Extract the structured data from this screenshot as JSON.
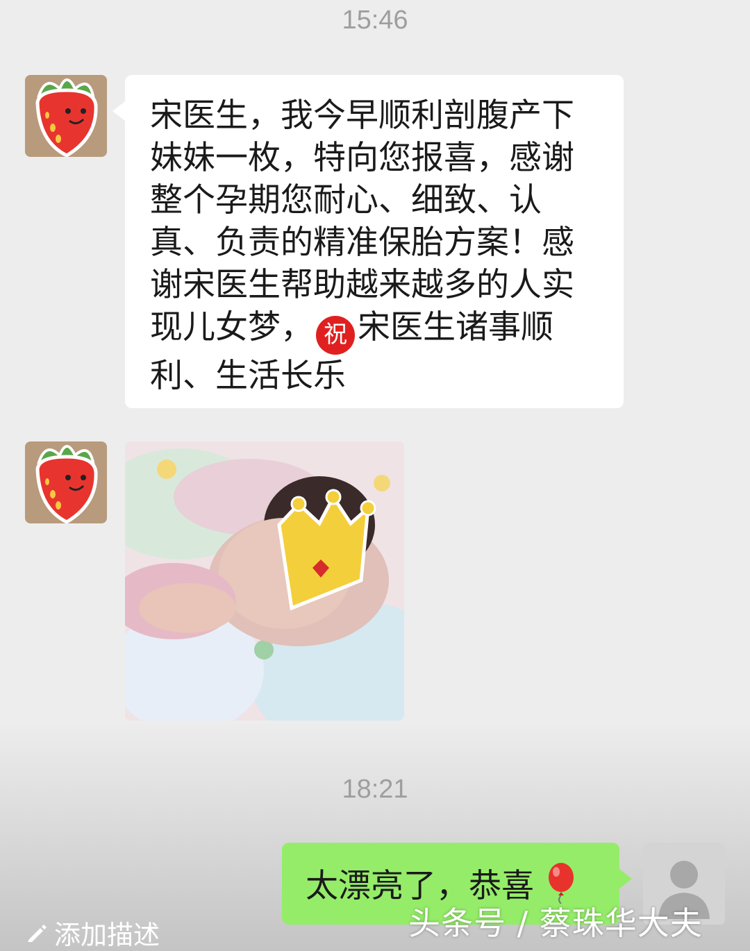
{
  "chat": {
    "timestamp_1": "15:46",
    "message_1_lines": [
      "宋医生，我今早顺利剖腹产下",
      "妹妹一枚，特向您报喜，感谢",
      "整个孕期您耐心、细致、认",
      "真、负责的精准保胎方案！感",
      "谢宋医生帮助越来越多的人实",
      "现儿女梦，",
      "宋医生诸事顺",
      "利、生活长乐"
    ],
    "blessing_badge": "祝",
    "timestamp_2": "18:21",
    "reply_text": "太漂亮了，恭喜"
  },
  "footer": {
    "add_description": "添加描述",
    "watermark": "头条号 / 蔡珠华大夫"
  },
  "icons": {
    "contact_avatar": "strawberry-icon",
    "reply_emoji": "balloon-icon",
    "edit": "pencil-icon",
    "self_avatar": "person-icon"
  },
  "colors": {
    "background": "#ededed",
    "incoming_bubble": "#ffffff",
    "outgoing_bubble": "#95ec69",
    "blessing_badge": "#e02020"
  }
}
